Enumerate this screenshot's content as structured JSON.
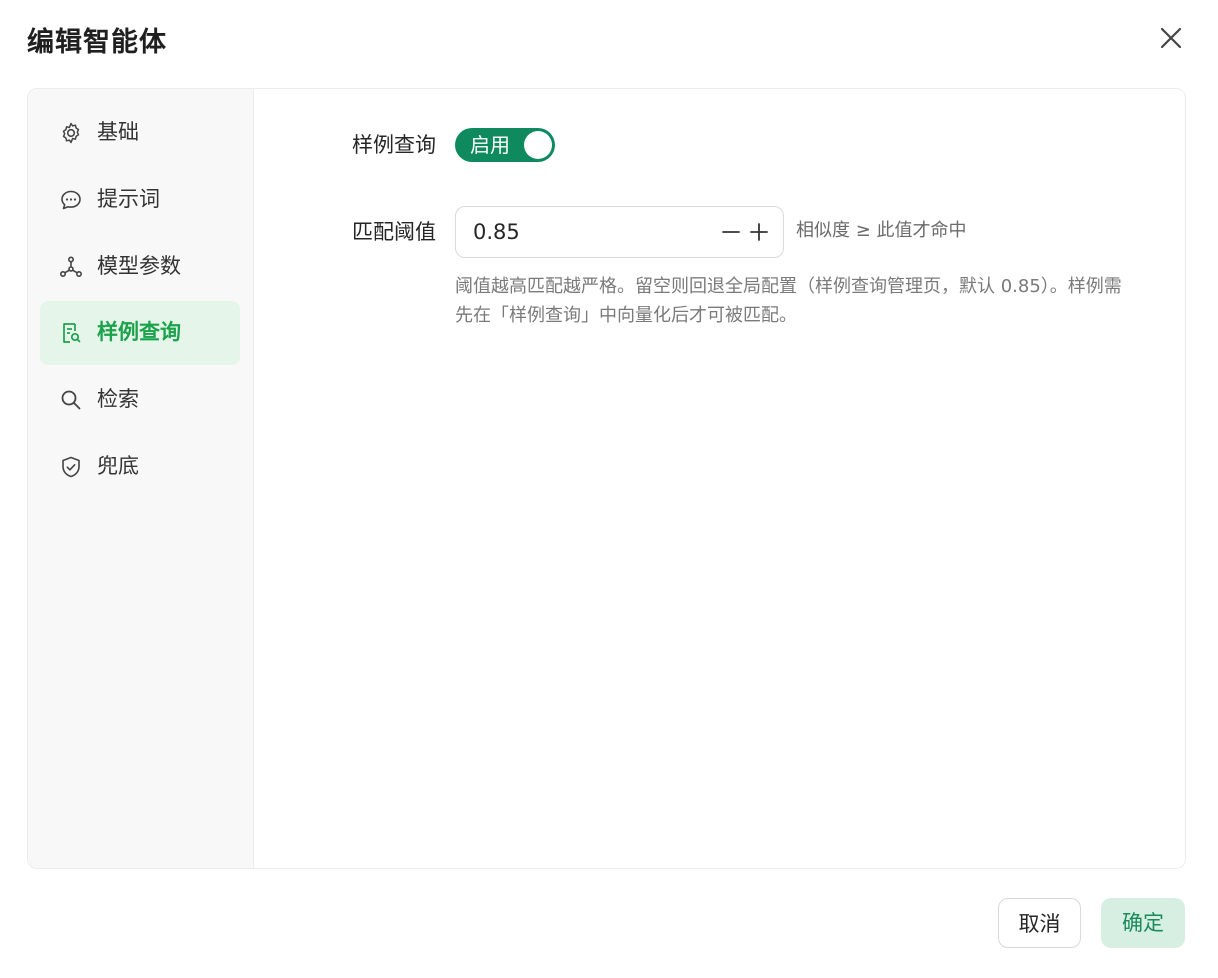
{
  "dialog": {
    "title": "编辑智能体"
  },
  "sidebar": {
    "items": [
      {
        "label": "基础",
        "icon": "gear-icon",
        "active": false
      },
      {
        "label": "提示词",
        "icon": "chat-bubble-icon",
        "active": false
      },
      {
        "label": "模型参数",
        "icon": "network-nodes-icon",
        "active": false
      },
      {
        "label": "样例查询",
        "icon": "document-search-icon",
        "active": true
      },
      {
        "label": "检索",
        "icon": "search-icon",
        "active": false
      },
      {
        "label": "兜底",
        "icon": "shield-check-icon",
        "active": false
      }
    ]
  },
  "form": {
    "enable_label": "样例查询",
    "toggle_text": "启用",
    "toggle_on": true,
    "threshold_label": "匹配阈值",
    "threshold_value": "0.85",
    "threshold_hint": "相似度 ≥ 此值才命中",
    "help_line1": "阈值越高匹配越严格。留空则回退全局配置（样例查询管理页，默认 0.85）。样例需",
    "help_line2": "先在「样例查询」中向量化后才可被匹配。"
  },
  "footer": {
    "cancel_label": "取消",
    "ok_label": "确定"
  },
  "colors": {
    "accent": "#0f8a5f",
    "active_text": "#1aa34a",
    "active_bg": "#e6f5ea",
    "ok_button_bg": "#d7efe3"
  }
}
